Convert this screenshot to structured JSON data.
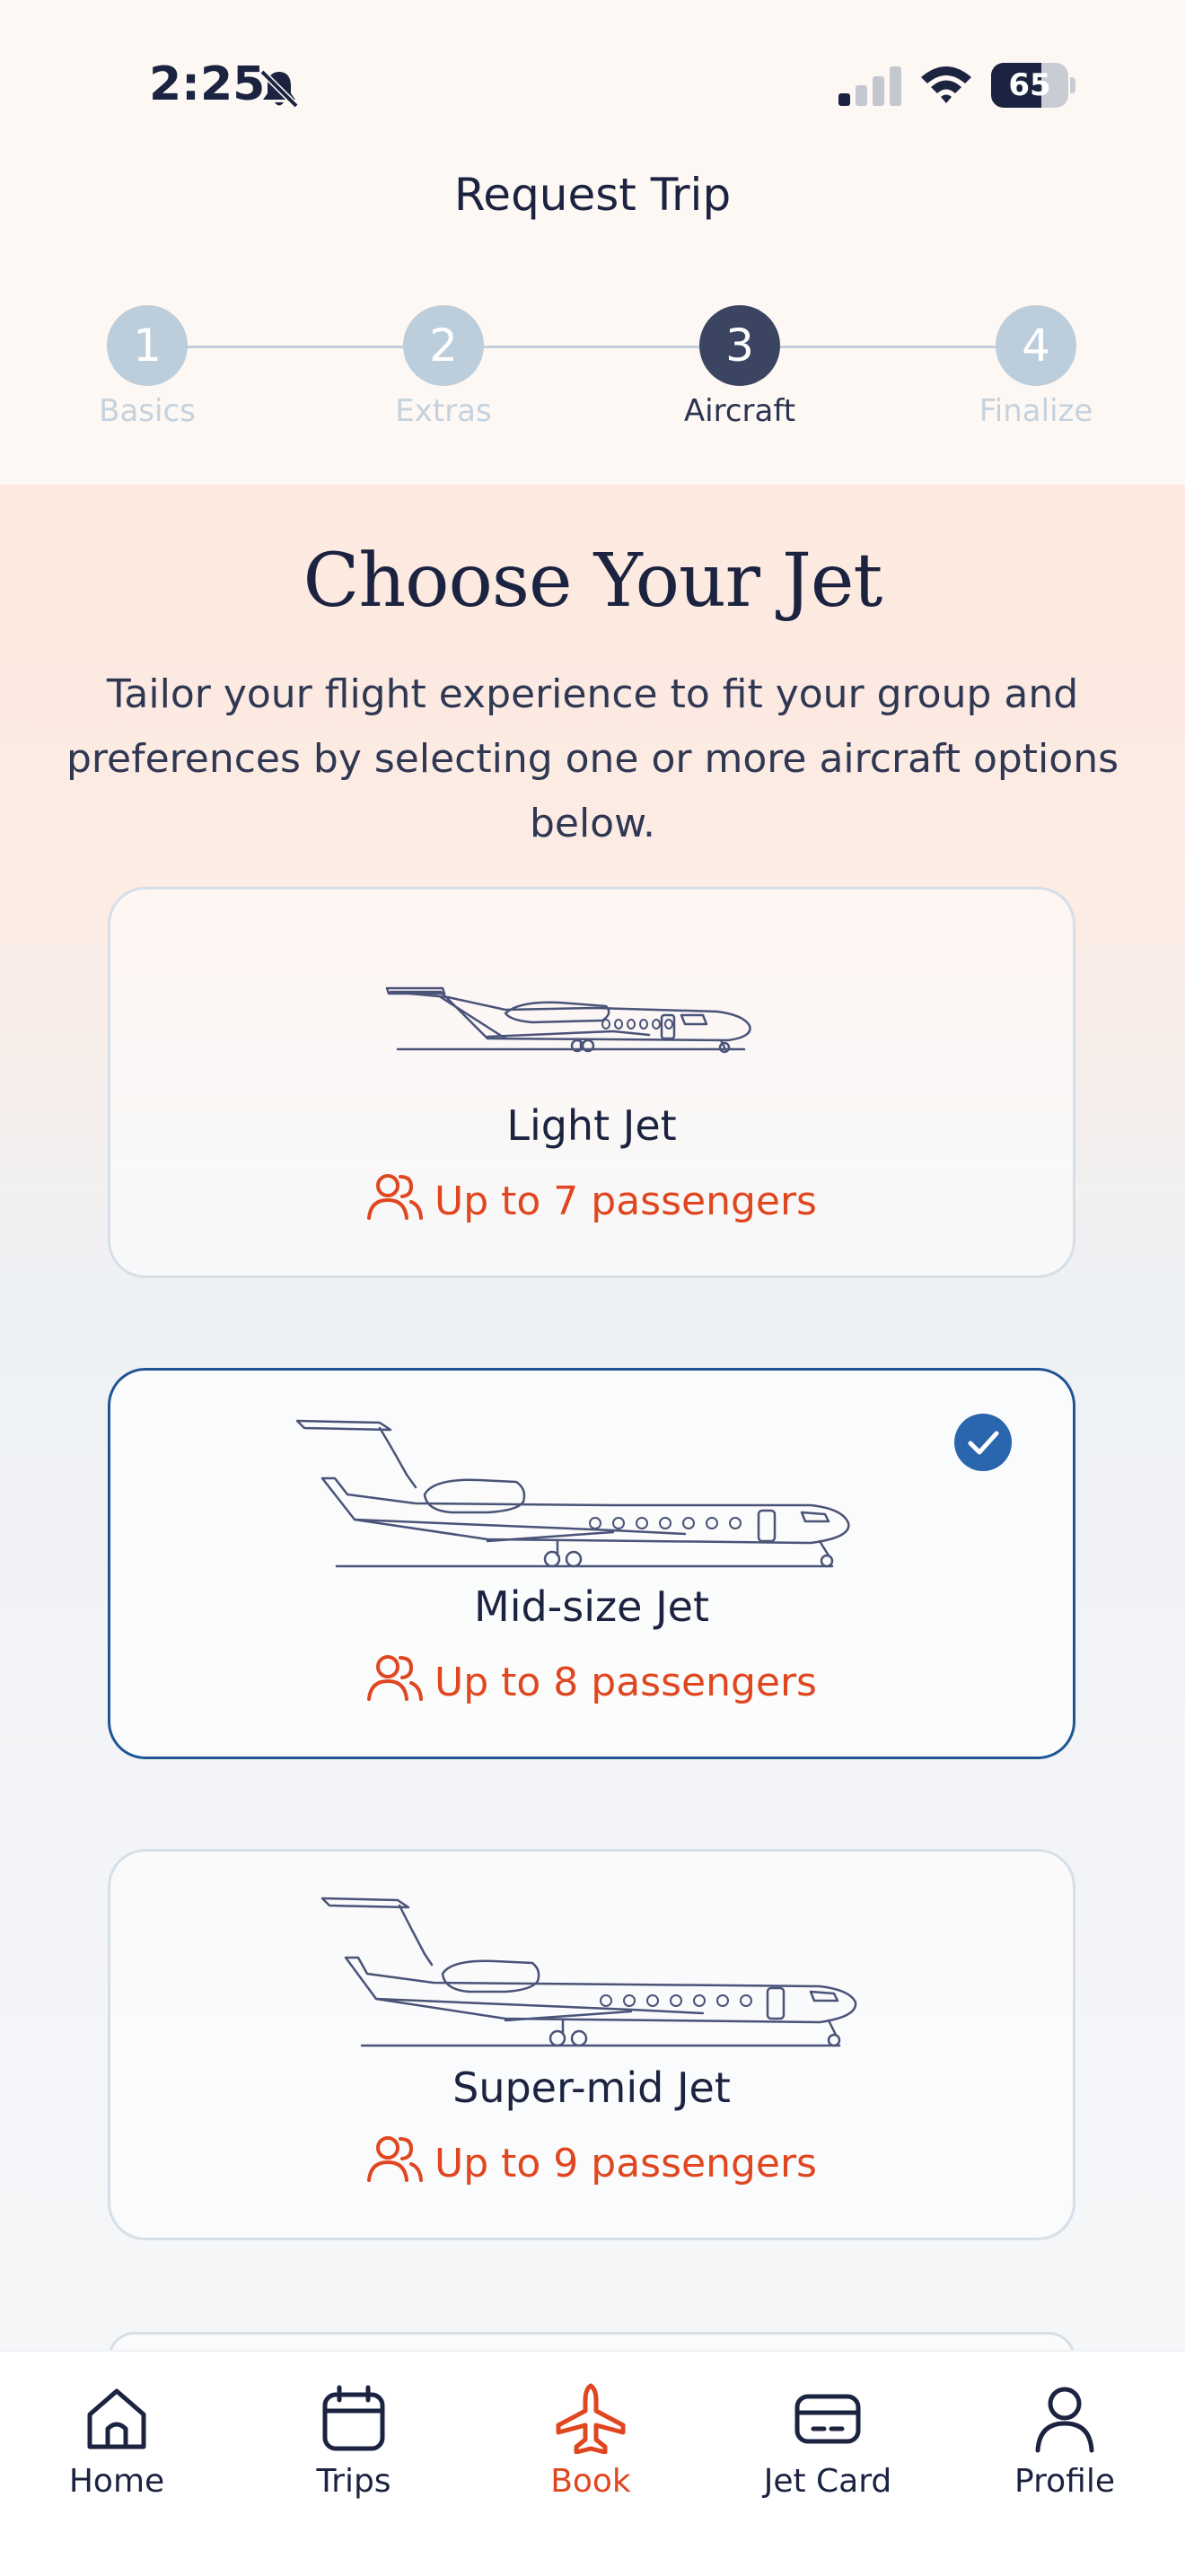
{
  "status_bar": {
    "time": "2:25",
    "battery": "65",
    "battery_level": 0.65
  },
  "header": {
    "title": "Request Trip"
  },
  "stepper": {
    "steps": [
      {
        "number": "1",
        "label": "Basics",
        "state": "upcoming"
      },
      {
        "number": "2",
        "label": "Extras",
        "state": "upcoming"
      },
      {
        "number": "3",
        "label": "Aircraft",
        "state": "active"
      },
      {
        "number": "4",
        "label": "Finalize",
        "state": "upcoming"
      }
    ]
  },
  "main": {
    "title": "Choose Your Jet",
    "subtitle": "Tailor your flight experience to fit your group and preferences by selecting one or more aircraft options below.",
    "jets": [
      {
        "name": "Light Jet",
        "passengers": "Up to 7 passengers",
        "selected": false,
        "icon": "light-jet-icon"
      },
      {
        "name": "Mid-size Jet",
        "passengers": "Up to 8 passengers",
        "selected": true,
        "icon": "midsize-jet-icon"
      },
      {
        "name": "Super-mid Jet",
        "passengers": "Up to 9 passengers",
        "selected": false,
        "icon": "supermid-jet-icon"
      }
    ]
  },
  "bottom_nav": {
    "items": [
      {
        "label": "Home",
        "icon": "home-icon"
      },
      {
        "label": "Trips",
        "icon": "calendar-icon"
      },
      {
        "label": "Book",
        "icon": "airplane-icon",
        "active": true
      },
      {
        "label": "Jet Card",
        "icon": "card-icon"
      },
      {
        "label": "Profile",
        "icon": "person-icon"
      }
    ]
  },
  "colors": {
    "accent": "#e0461f",
    "navy": "#1b2340",
    "selected_border": "#1f5592",
    "step_inactive": "#bccddc",
    "step_active": "#3b4561"
  }
}
